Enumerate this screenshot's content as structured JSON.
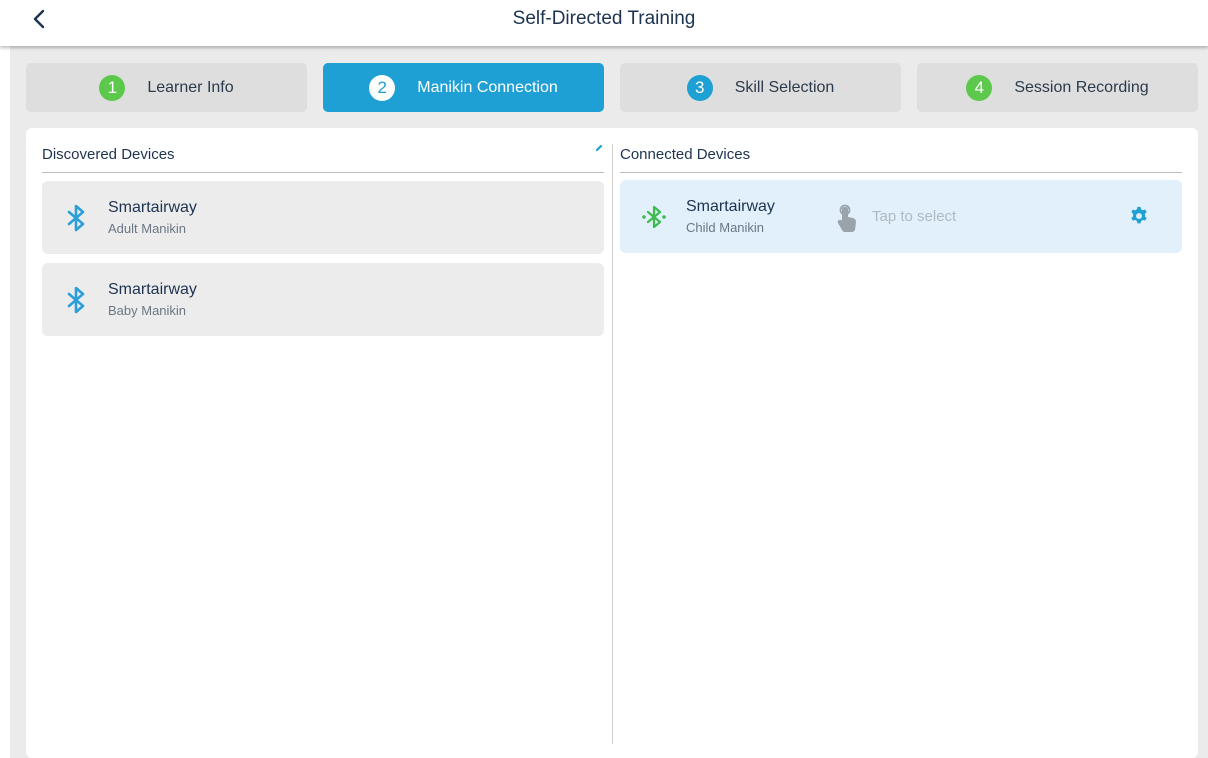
{
  "header": {
    "title": "Self-Directed Training"
  },
  "steps": [
    {
      "num": "1",
      "label": "Learner Info"
    },
    {
      "num": "2",
      "label": "Manikin Connection"
    },
    {
      "num": "3",
      "label": "Skill Selection"
    },
    {
      "num": "4",
      "label": "Session Recording"
    }
  ],
  "discovered": {
    "title": "Discovered Devices",
    "devices": [
      {
        "name": "Smartairway",
        "type": "Adult Manikin"
      },
      {
        "name": "Smartairway",
        "type": "Baby Manikin"
      }
    ]
  },
  "connected": {
    "title": "Connected Devices",
    "devices": [
      {
        "name": "Smartairway",
        "type": "Child Manikin",
        "action": "Tap to select"
      }
    ]
  },
  "colors": {
    "accent": "#1fa0d4",
    "step_green": "#5cc94c",
    "bluetooth_blue": "#2a9fd8",
    "bluetooth_connected_green": "#3dbb4e",
    "connected_bg": "#e2f0fb"
  },
  "icons": {
    "back": "chevron-left-icon",
    "bluetooth": "bluetooth-icon",
    "bluetooth_connected": "bluetooth-connected-icon",
    "tap": "tap-hand-icon",
    "settings": "gear-icon"
  }
}
